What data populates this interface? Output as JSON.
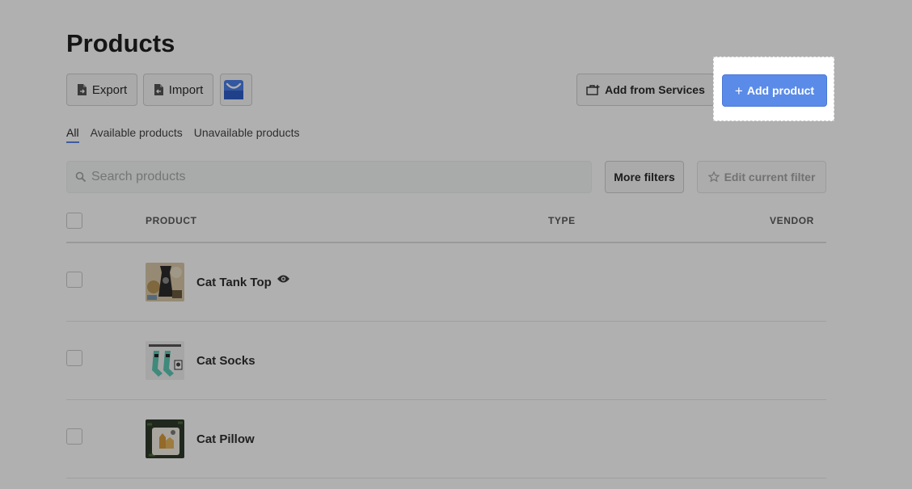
{
  "page": {
    "title": "Products"
  },
  "toolbar": {
    "export_label": "Export",
    "import_label": "Import",
    "add_from_services_label": "Add from Services",
    "add_product_label": "Add product"
  },
  "tabs": [
    {
      "label": "All",
      "active": true
    },
    {
      "label": "Available products",
      "active": false
    },
    {
      "label": "Unavailable products",
      "active": false
    }
  ],
  "search": {
    "placeholder": "Search products"
  },
  "filters": {
    "more_label": "More filters",
    "edit_label": "Edit current filter"
  },
  "table": {
    "columns": [
      "PRODUCT",
      "TYPE",
      "VENDOR"
    ],
    "rows": [
      {
        "name": "Cat Tank Top",
        "type": "",
        "vendor": "",
        "preview_icon": "eye-icon"
      },
      {
        "name": "Cat Socks",
        "type": "",
        "vendor": ""
      },
      {
        "name": "Cat Pillow",
        "type": "",
        "vendor": ""
      }
    ]
  },
  "colors": {
    "accent": "#5a8be8",
    "overlay": "rgba(0,0,0,0.31)"
  }
}
